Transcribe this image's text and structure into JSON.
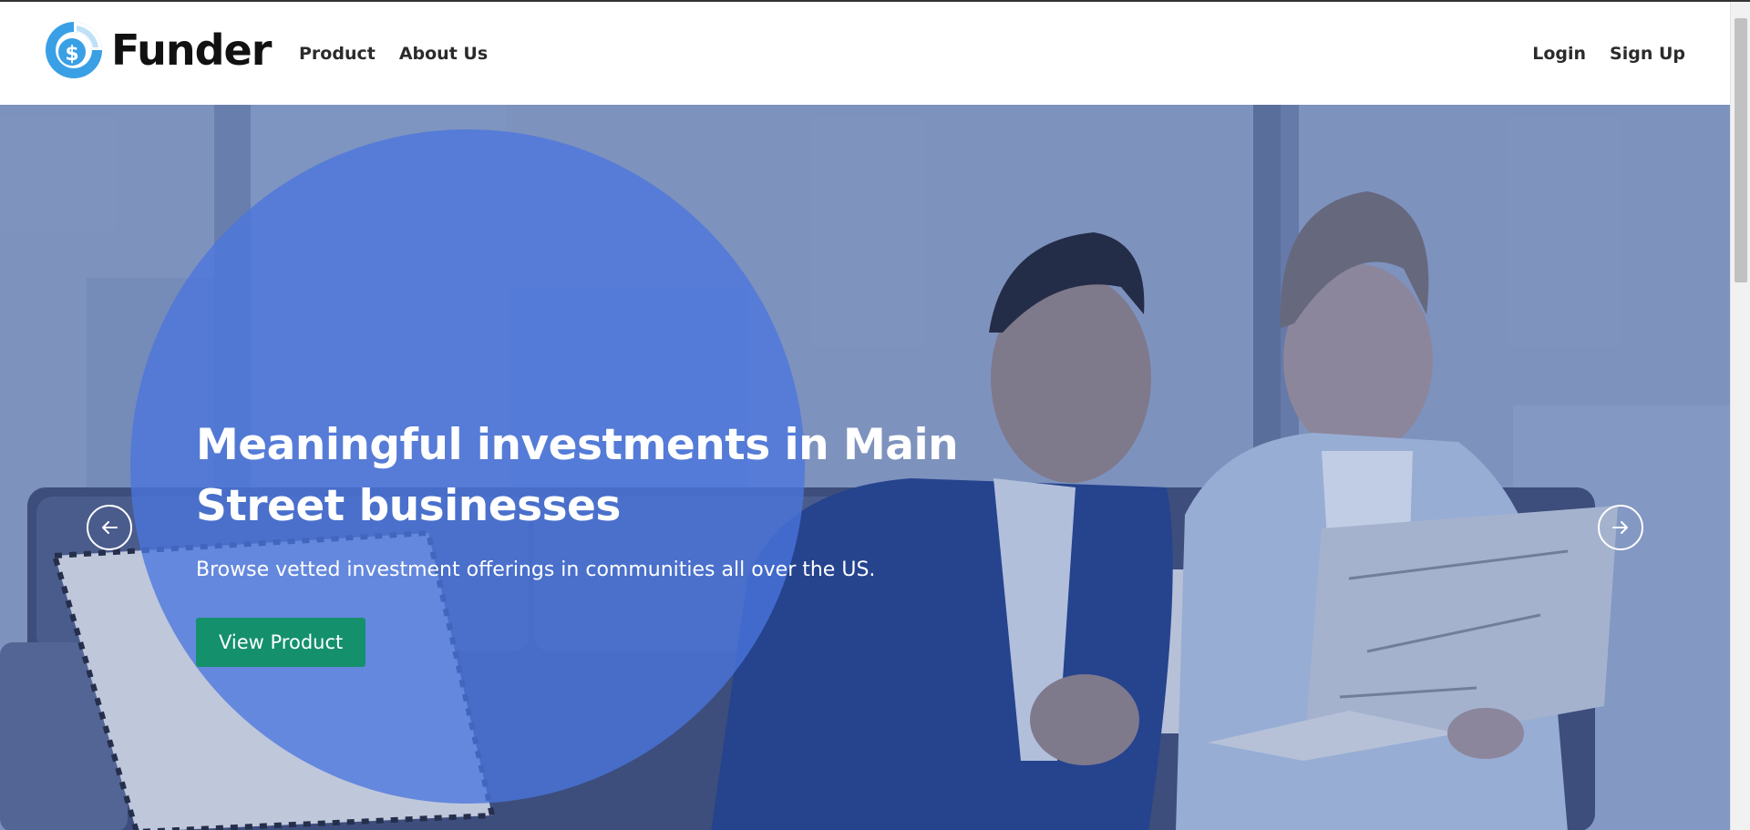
{
  "header": {
    "brand": "Funder",
    "nav_left": [
      {
        "label": "Product"
      },
      {
        "label": "About Us"
      }
    ],
    "nav_right": [
      {
        "label": "Login"
      },
      {
        "label": "Sign Up"
      }
    ]
  },
  "hero": {
    "title": "Meaningful investments in Main Street businesses",
    "subtitle": "Browse vetted investment offerings in communities all over the US.",
    "cta_label": "View Product",
    "prev_icon": "arrow-left-icon",
    "next_icon": "arrow-right-icon"
  },
  "colors": {
    "brand_blue": "#3aa0e6",
    "accent_circle": "#4a76de",
    "cta_green": "#14906c",
    "hero_tint": "#7e93bc"
  }
}
